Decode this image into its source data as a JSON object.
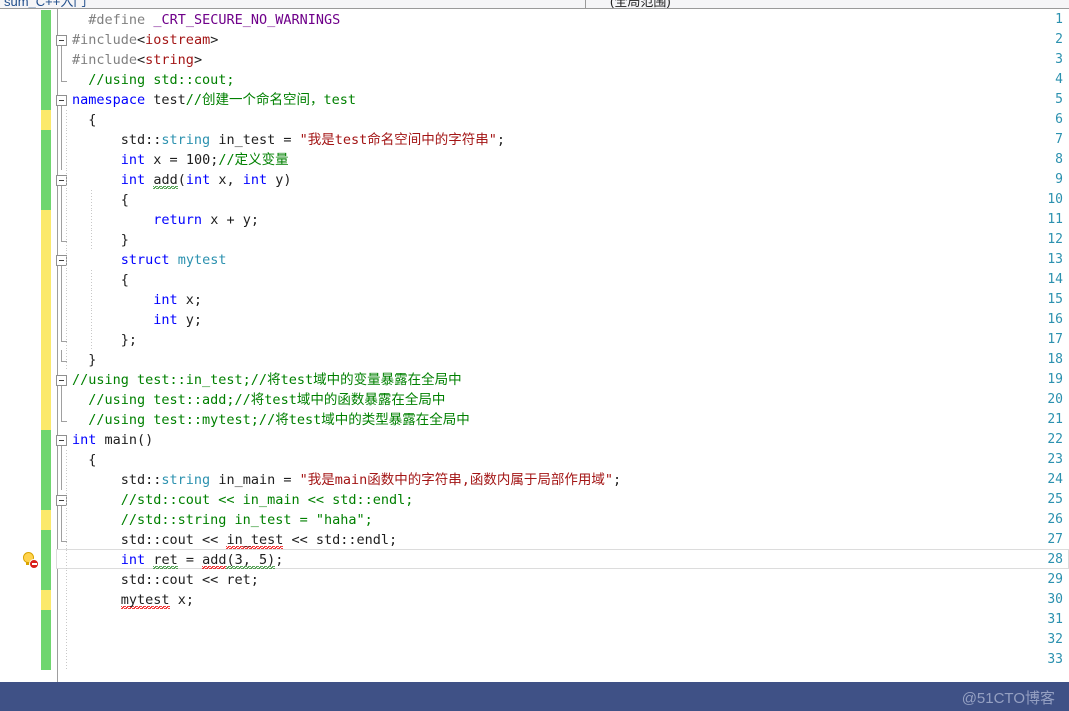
{
  "window": {
    "tab_label": "sum_C++入门",
    "scope_label": "(全局范围)"
  },
  "editor": {
    "current_line": 28,
    "diagnostic_icon": "lightbulb-error-icon",
    "gutter_legend": {
      "saved_color": "#6fd66f",
      "unsaved_color": "#fbe96b"
    },
    "line_number_color": "#2b91af",
    "lines": [
      {
        "n": 1,
        "track": "saved",
        "fold": "none",
        "indent": 0,
        "tokens": [
          {
            "t": "  ",
            "c": "plain"
          },
          {
            "t": "#define",
            "c": "pp"
          },
          {
            "t": " ",
            "c": "plain"
          },
          {
            "t": "_CRT_SECURE_NO_WARNINGS",
            "c": "ppid"
          }
        ]
      },
      {
        "n": 2,
        "track": "saved",
        "fold": "open",
        "indent": 0,
        "tokens": [
          {
            "t": "#include",
            "c": "pp"
          },
          {
            "t": "<",
            "c": "plain"
          },
          {
            "t": "iostream",
            "c": "hdr"
          },
          {
            "t": ">",
            "c": "plain"
          }
        ]
      },
      {
        "n": 3,
        "track": "saved",
        "fold": "mid",
        "indent": 0,
        "tokens": [
          {
            "t": "#include",
            "c": "pp"
          },
          {
            "t": "<",
            "c": "plain"
          },
          {
            "t": "string",
            "c": "hdr"
          },
          {
            "t": ">",
            "c": "plain"
          }
        ]
      },
      {
        "n": 4,
        "track": "saved",
        "fold": "endtop",
        "indent": 0,
        "tokens": [
          {
            "t": "  //using std::cout;",
            "c": "cmt"
          }
        ]
      },
      {
        "n": 5,
        "track": "saved",
        "fold": "open",
        "indent": 0,
        "tokens": [
          {
            "t": "namespace",
            "c": "kw"
          },
          {
            "t": " test",
            "c": "plain"
          },
          {
            "t": "//创建一个命名空间，test",
            "c": "cmt"
          }
        ]
      },
      {
        "n": 6,
        "track": "unsaved",
        "fold": "mid",
        "indent": 1,
        "tokens": [
          {
            "t": "  {",
            "c": "plain"
          }
        ]
      },
      {
        "n": 7,
        "track": "saved",
        "fold": "mid",
        "indent": 1,
        "tokens": [
          {
            "t": "      std::",
            "c": "plain"
          },
          {
            "t": "string",
            "c": "typ"
          },
          {
            "t": " in_test = ",
            "c": "plain"
          },
          {
            "t": "\"我是test命名空间中的字符串\"",
            "c": "str"
          },
          {
            "t": ";",
            "c": "plain"
          }
        ]
      },
      {
        "n": 8,
        "track": "saved",
        "fold": "mid",
        "indent": 1,
        "tokens": [
          {
            "t": "      ",
            "c": "plain"
          },
          {
            "t": "int",
            "c": "kw"
          },
          {
            "t": " x = ",
            "c": "plain"
          },
          {
            "t": "100",
            "c": "num"
          },
          {
            "t": ";",
            "c": "plain"
          },
          {
            "t": "//定义变量",
            "c": "cmt"
          }
        ]
      },
      {
        "n": 9,
        "track": "saved",
        "fold": "open2",
        "indent": 1,
        "tokens": [
          {
            "t": "      ",
            "c": "plain"
          },
          {
            "t": "int",
            "c": "kw"
          },
          {
            "t": " ",
            "c": "plain"
          },
          {
            "t": "add",
            "c": "plain",
            "sq": "grn"
          },
          {
            "t": "(",
            "c": "plain"
          },
          {
            "t": "int",
            "c": "kw"
          },
          {
            "t": " x, ",
            "c": "plain"
          },
          {
            "t": "int",
            "c": "kw"
          },
          {
            "t": " y)",
            "c": "plain"
          }
        ]
      },
      {
        "n": 10,
        "track": "saved",
        "fold": "mid",
        "indent": 2,
        "tokens": [
          {
            "t": "      {",
            "c": "plain"
          }
        ]
      },
      {
        "n": 11,
        "track": "unsaved",
        "fold": "mid",
        "indent": 2,
        "tokens": [
          {
            "t": "          ",
            "c": "plain"
          },
          {
            "t": "return",
            "c": "kw"
          },
          {
            "t": " x + y;",
            "c": "plain"
          }
        ]
      },
      {
        "n": 12,
        "track": "unsaved",
        "fold": "endtop2",
        "indent": 2,
        "tokens": [
          {
            "t": "      }",
            "c": "plain"
          }
        ]
      },
      {
        "n": 13,
        "track": "unsaved",
        "fold": "open3",
        "indent": 1,
        "tokens": [
          {
            "t": "      ",
            "c": "plain"
          },
          {
            "t": "struct",
            "c": "kw"
          },
          {
            "t": " ",
            "c": "plain"
          },
          {
            "t": "mytest",
            "c": "typ"
          }
        ]
      },
      {
        "n": 14,
        "track": "unsaved",
        "fold": "mid3",
        "indent": 2,
        "tokens": [
          {
            "t": "      {",
            "c": "plain"
          }
        ]
      },
      {
        "n": 15,
        "track": "unsaved",
        "fold": "mid3",
        "indent": 2,
        "tokens": [
          {
            "t": "          ",
            "c": "plain"
          },
          {
            "t": "int",
            "c": "kw"
          },
          {
            "t": " x;",
            "c": "plain"
          }
        ]
      },
      {
        "n": 16,
        "track": "unsaved",
        "fold": "mid3",
        "indent": 2,
        "tokens": [
          {
            "t": "          ",
            "c": "plain"
          },
          {
            "t": "int",
            "c": "kw"
          },
          {
            "t": " y;",
            "c": "plain"
          }
        ]
      },
      {
        "n": 17,
        "track": "unsaved",
        "fold": "end3",
        "indent": 2,
        "tokens": [
          {
            "t": "      };",
            "c": "plain"
          }
        ]
      },
      {
        "n": 18,
        "track": "unsaved",
        "fold": "end1",
        "indent": 1,
        "tokens": [
          {
            "t": "  }",
            "c": "plain"
          }
        ]
      },
      {
        "n": 19,
        "track": "unsaved",
        "fold": "open",
        "indent": 0,
        "tokens": [
          {
            "t": "//using test::in_test;//将test域中的变量暴露在全局中",
            "c": "cmt"
          }
        ]
      },
      {
        "n": 20,
        "track": "unsaved",
        "fold": "mid",
        "indent": 0,
        "tokens": [
          {
            "t": "  //using test::add;//将test域中的函数暴露在全局中",
            "c": "cmt"
          }
        ]
      },
      {
        "n": 21,
        "track": "unsaved",
        "fold": "endtop",
        "indent": 0,
        "tokens": [
          {
            "t": "  //using test::mytest;//将test域中的类型暴露在全局中",
            "c": "cmt"
          }
        ]
      },
      {
        "n": 22,
        "track": "saved",
        "fold": "open",
        "indent": 0,
        "tokens": [
          {
            "t": "int",
            "c": "kw"
          },
          {
            "t": " ",
            "c": "plain"
          },
          {
            "t": "main",
            "c": "plain"
          },
          {
            "t": "()",
            "c": "plain"
          }
        ]
      },
      {
        "n": 23,
        "track": "saved",
        "fold": "mid",
        "indent": 1,
        "tokens": [
          {
            "t": "  {",
            "c": "plain"
          }
        ]
      },
      {
        "n": 24,
        "track": "saved",
        "fold": "mid",
        "indent": 1,
        "tokens": [
          {
            "t": "      std::",
            "c": "plain"
          },
          {
            "t": "string",
            "c": "typ"
          },
          {
            "t": " in_main = ",
            "c": "plain"
          },
          {
            "t": "\"我是main函数中的字符串,函数内属于局部作用域\"",
            "c": "str"
          },
          {
            "t": ";",
            "c": "plain"
          }
        ]
      },
      {
        "n": 25,
        "track": "saved",
        "fold": "open4",
        "indent": 1,
        "tokens": [
          {
            "t": "      //std::cout << in_main << std::endl;",
            "c": "cmt"
          }
        ]
      },
      {
        "n": 26,
        "track": "unsaved",
        "fold": "mid4",
        "indent": 1,
        "tokens": [
          {
            "t": "      //std::string in_test = \"haha\";",
            "c": "cmt"
          }
        ]
      },
      {
        "n": 27,
        "track": "saved",
        "fold": "end4",
        "indent": 1,
        "tokens": [
          {
            "t": "      std::cout << ",
            "c": "plain"
          },
          {
            "t": "in_test",
            "c": "plain",
            "sq": "red"
          },
          {
            "t": " << std::endl;",
            "c": "plain"
          }
        ]
      },
      {
        "n": 28,
        "track": "saved",
        "fold": "none",
        "indent": 1,
        "current": true,
        "tokens": [
          {
            "t": "      ",
            "c": "plain"
          },
          {
            "t": "int",
            "c": "kw"
          },
          {
            "t": " ",
            "c": "plain"
          },
          {
            "t": "ret",
            "c": "plain",
            "sq": "grn"
          },
          {
            "t": " = ",
            "c": "plain"
          },
          {
            "t": "add",
            "c": "plain",
            "sq": "red"
          },
          {
            "t": "(3, 5)",
            "c": "plain",
            "sq": "grn"
          },
          {
            "t": ";",
            "c": "plain"
          }
        ]
      },
      {
        "n": 29,
        "track": "saved",
        "fold": "none",
        "indent": 1,
        "tokens": [
          {
            "t": "      std::cout << ret;",
            "c": "plain"
          }
        ]
      },
      {
        "n": 30,
        "track": "unsaved",
        "fold": "none",
        "indent": 1,
        "tokens": [
          {
            "t": "      ",
            "c": "plain"
          },
          {
            "t": "mytest",
            "c": "plain",
            "sq": "red"
          },
          {
            "t": " x;",
            "c": "plain"
          }
        ]
      },
      {
        "n": 31,
        "track": "saved",
        "fold": "none",
        "indent": 1,
        "tokens": []
      },
      {
        "n": 32,
        "track": "saved",
        "fold": "none",
        "indent": 1,
        "tokens": []
      },
      {
        "n": 33,
        "track": "saved",
        "fold": "none",
        "indent": 1,
        "tokens": []
      }
    ]
  },
  "watermark": {
    "text": "@51CTO博客",
    "color": "#95a0c2",
    "bar_color": "#3f5186"
  }
}
